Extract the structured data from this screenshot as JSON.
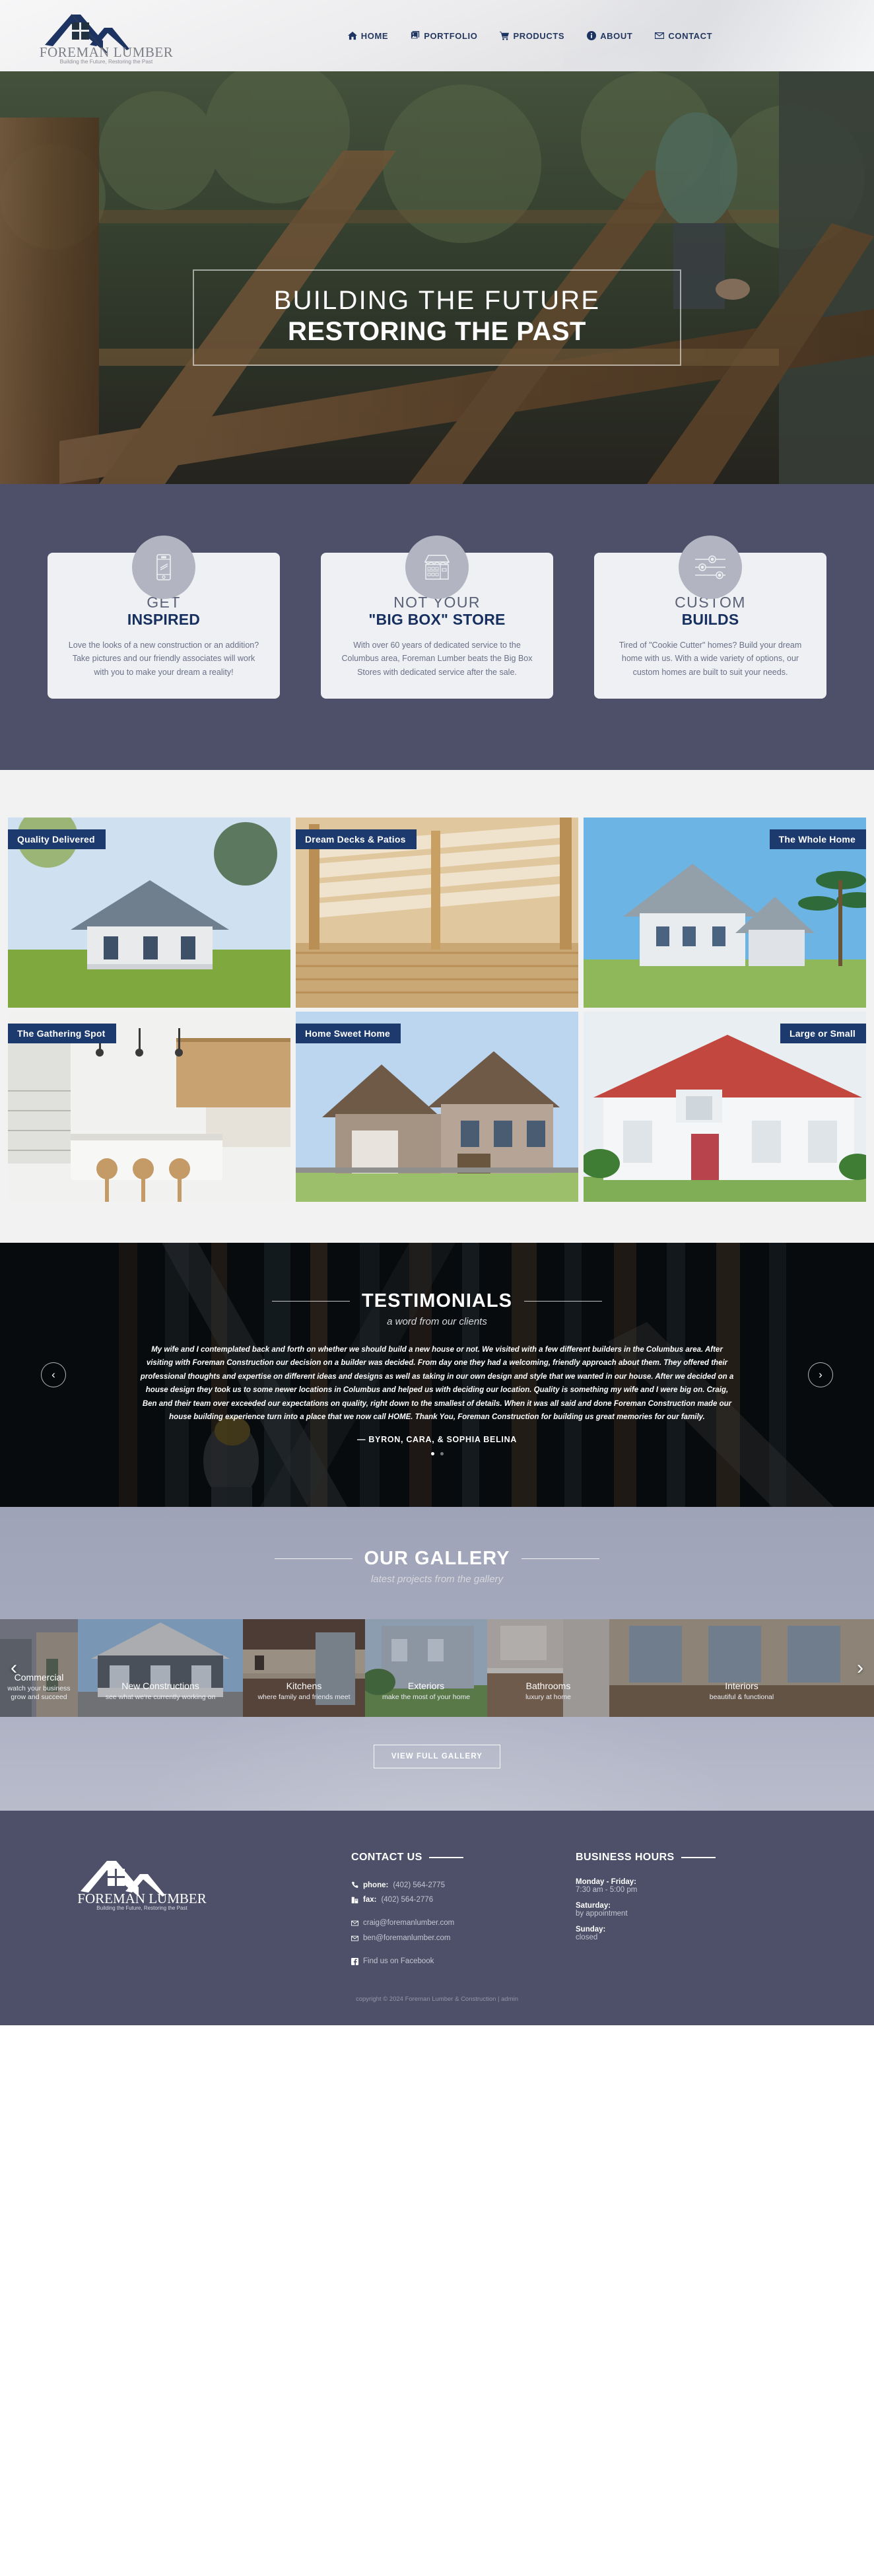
{
  "brand": {
    "name_line1": "FOREMAN LUMBER",
    "tagline": "Building the Future, Restoring the Past",
    "navy": "#1d3361",
    "slate": "#4d5068"
  },
  "nav": {
    "items": [
      {
        "label": "HOME",
        "icon": "home-icon"
      },
      {
        "label": "PORTFOLIO",
        "icon": "image-icon"
      },
      {
        "label": "PRODUCTS",
        "icon": "cart-icon"
      },
      {
        "label": "ABOUT",
        "icon": "info-icon"
      },
      {
        "label": "CONTACT",
        "icon": "envelope-icon"
      }
    ]
  },
  "hero": {
    "line1": "BUILDING THE FUTURE",
    "line2": "RESTORING THE PAST"
  },
  "features": [
    {
      "icon": "smartphone-icon",
      "title_light": "GET",
      "title_bold": "INSPIRED",
      "body": "Love the looks of a new construction or an addition? Take pictures and our friendly associates will work with you to make your dream a reality!"
    },
    {
      "icon": "storefront-icon",
      "title_light": "NOT YOUR",
      "title_bold": "\"BIG BOX\" STORE",
      "body": "With over 60 years of dedicated service to the Columbus area, Foreman Lumber beats the Big Box Stores with dedicated service after the sale."
    },
    {
      "icon": "sliders-icon",
      "title_light": "CUSTOM",
      "title_bold": "BUILDS",
      "body": "Tired of \"Cookie Cutter\" homes? Build your dream home with us. With a wide variety of options, our custom homes are built to suit your needs."
    }
  ],
  "grid_tiles": [
    {
      "label": "Quality Delivered",
      "align": "left"
    },
    {
      "label": "Dream Decks & Patios",
      "align": "left"
    },
    {
      "label": "The Whole Home",
      "align": "right"
    },
    {
      "label": "The Gathering Spot",
      "align": "left"
    },
    {
      "label": "Home Sweet Home",
      "align": "left"
    },
    {
      "label": "Large or Small",
      "align": "right"
    }
  ],
  "testimonials": {
    "title": "TESTIMONIALS",
    "subtitle": "a word from our clients",
    "quote": "My wife and I contemplated back and forth on whether we should build a new house or not. We visited with a few different builders in the Columbus area. After visiting with Foreman Construction our decision on a builder was decided. From day one they had a welcoming, friendly approach about them. They offered their professional thoughts and expertise on different ideas and designs as well as taking in our own design and style that we wanted in our house. After we decided on a house design they took us to some newer locations in Columbus and helped us with deciding our location. Quality is something my wife and I were big on. Craig, Ben and their team over exceeded our expectations on quality, right down to the smallest of details. When it was all said and done Foreman Construction made our house building experience turn into a place that we now call HOME. Thank You, Foreman Construction for building us great memories for our family.",
    "author": "— BYRON, CARA, & SOPHIA BELINA",
    "prev_icon": "chevron-left-icon",
    "next_icon": "chevron-right-icon",
    "dots": 2,
    "active_dot": 0
  },
  "gallery": {
    "title": "OUR GALLERY",
    "subtitle": "latest projects from the gallery",
    "prev_icon": "chevron-left-icon",
    "next_icon": "chevron-right-icon",
    "button_label": "VIEW FULL GALLERY",
    "slides": [
      {
        "title": "Commercial",
        "subtitle": "watch your business grow and succeed"
      },
      {
        "title": "New Constructions",
        "subtitle": "see what we're currently working on"
      },
      {
        "title": "Kitchens",
        "subtitle": "where family and friends meet"
      },
      {
        "title": "Exteriors",
        "subtitle": "make the most of your home"
      },
      {
        "title": "Bathrooms",
        "subtitle": "luxury at home"
      },
      {
        "title": "Interiors",
        "subtitle": "beautiful & functional"
      }
    ]
  },
  "footer": {
    "contact_heading": "CONTACT US",
    "hours_heading": "BUSINESS HOURS",
    "phone_label": "phone:",
    "phone_value": "(402) 564-2775",
    "fax_label": "fax:",
    "fax_value": "(402) 564-2776",
    "email1": "craig@foremanlumber.com",
    "email2": "ben@foremanlumber.com",
    "facebook": "Find us on Facebook",
    "hours": [
      {
        "label": "Monday - Friday:",
        "value": "7:30 am - 5:00 pm"
      },
      {
        "label": "Saturday:",
        "value": "by appointment"
      },
      {
        "label": "Sunday:",
        "value": "closed"
      }
    ],
    "copyright": "copyright © 2024 Foreman Lumber & Construction   |   admin"
  }
}
